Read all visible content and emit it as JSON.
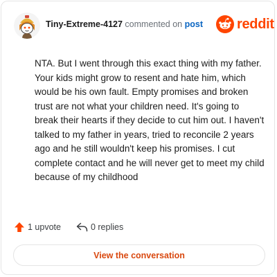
{
  "header": {
    "username": "Tiny-Extreme-4127",
    "action_text": "commented on",
    "target_link": "post",
    "avatar_icon": "snoo-avatar-icon",
    "brand_logo": "reddit"
  },
  "comment": {
    "text": "NTA. But I went through this exact thing with my father. Your kids might grow to resent and hate him, which would be his own fault. Empty promises and broken trust are not what your children need. It's going to break their hearts if they decide to cut him out. I haven't talked to my father in years, tried to reconcile 2 years ago and he still wouldn't keep his promises. I cut complete contact and he will never get to meet my child because of my childhood"
  },
  "actions": {
    "upvote_label": "1 upvote",
    "upvote_icon": "upvote-arrow-icon",
    "replies_label": "0 replies",
    "reply_icon": "reply-arrow-icon"
  },
  "footer": {
    "view_button_label": "View the conversation"
  },
  "colors": {
    "brand": "#ff4500",
    "link": "#0a65c2",
    "button_text": "#d9480f"
  }
}
